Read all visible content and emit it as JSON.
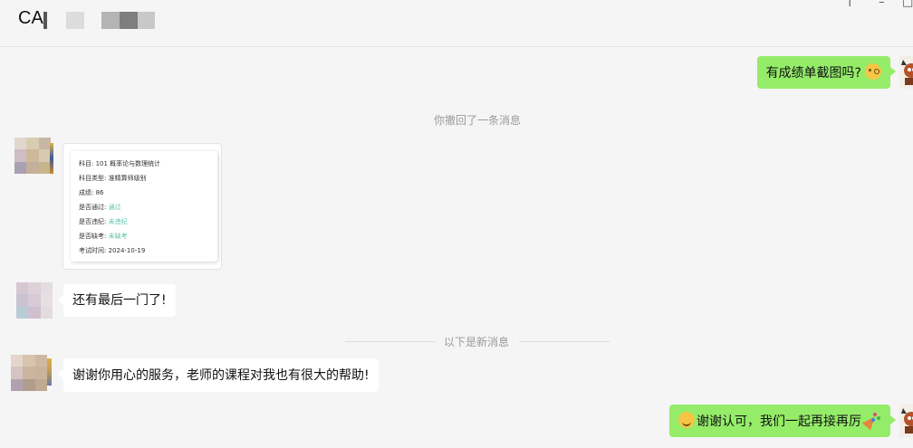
{
  "header": {
    "title": "CA",
    "window_controls": {
      "pin_icon": "†",
      "minimize_icon": "–",
      "maximize_icon": "□"
    }
  },
  "messages": [
    {
      "side": "right",
      "text": "有成绩单截图吗?",
      "emoji": "thinking-face"
    },
    {
      "type": "system",
      "text": "你撤回了一条消息"
    },
    {
      "side": "left",
      "type": "image",
      "card": {
        "rows": [
          {
            "label": "科目:",
            "value": "101 概率论与数理统计"
          },
          {
            "label": "科目类型:",
            "value": "准精算师级别"
          },
          {
            "label": "成绩:",
            "value": "86"
          },
          {
            "label": "是否通过:",
            "value": "通过"
          },
          {
            "label": "是否违纪:",
            "value": "未违纪"
          },
          {
            "label": "是否缺考:",
            "value": "未缺考"
          },
          {
            "label": "考试时间:",
            "value": "2024-10-19"
          }
        ]
      }
    },
    {
      "side": "left",
      "text": "还有最后一门了!"
    },
    {
      "type": "divider",
      "text": "以下是新消息"
    },
    {
      "side": "left",
      "text": "谢谢你用心的服务，老师的课程对我也有很大的帮助!"
    },
    {
      "side": "right",
      "text": "谢谢认可，我们一起再接再厉",
      "emoji_before": "smiling-face",
      "emoji_after": "party-popper"
    }
  ],
  "colors": {
    "background": "#f5f5f5",
    "my_bubble": "#95ec69",
    "their_bubble": "#ffffff",
    "system_text": "#9a9a9a",
    "card_pass_value": "#59c6a8"
  }
}
